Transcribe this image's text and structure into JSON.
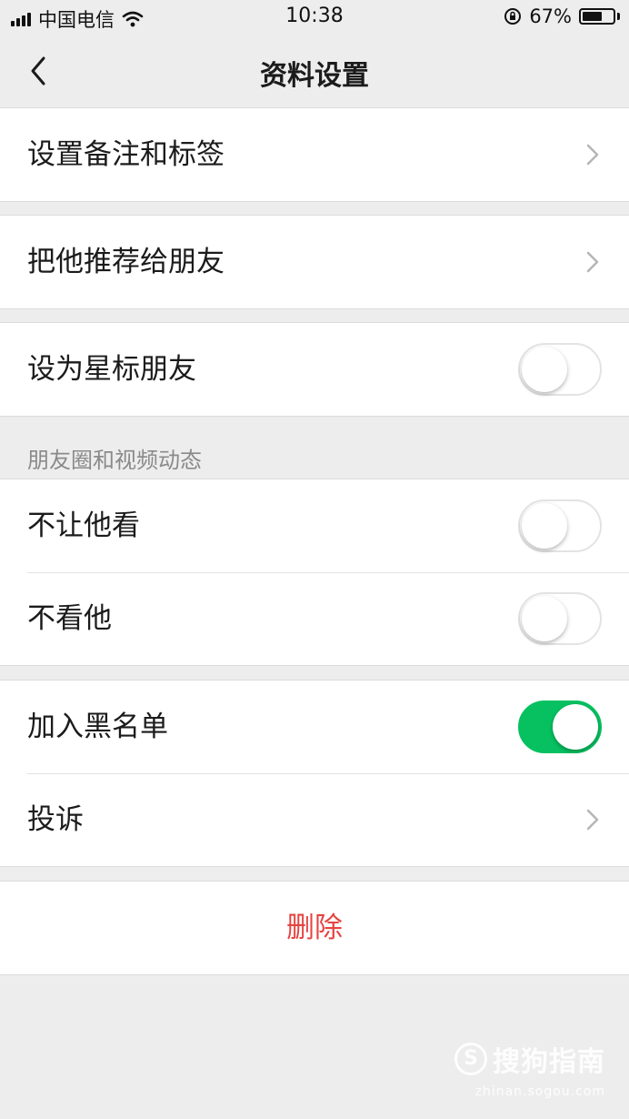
{
  "status_bar": {
    "carrier": "中国电信",
    "time": "10:38",
    "battery": "67%",
    "battery_level": 0.67
  },
  "nav": {
    "title": "资料设置"
  },
  "rows": {
    "remark": {
      "label": "设置备注和标签"
    },
    "recommend": {
      "label": "把他推荐给朋友"
    },
    "star": {
      "label": "设为星标朋友",
      "enabled": false
    },
    "hide_my_moments": {
      "label": "不让他看",
      "enabled": false
    },
    "hide_his_moments": {
      "label": "不看他",
      "enabled": false
    },
    "blacklist": {
      "label": "加入黑名单",
      "enabled": true
    },
    "report": {
      "label": "投诉"
    }
  },
  "moments_section": {
    "header": "朋友圈和视频动态"
  },
  "delete": {
    "label": "删除"
  },
  "colors": {
    "accent_green": "#07c160",
    "danger_red": "#e64340"
  },
  "watermark": {
    "logo_letter": "S",
    "name": "搜狗指南",
    "url": "zhinan.sogou.com"
  }
}
